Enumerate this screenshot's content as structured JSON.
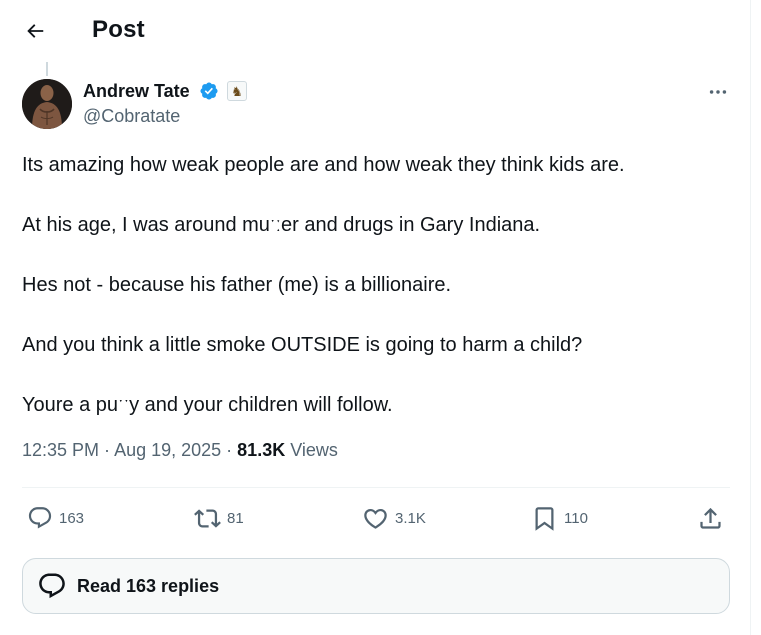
{
  "header": {
    "title": "Post"
  },
  "author": {
    "display_name": "Andrew Tate",
    "handle": "@Cobratate",
    "affiliation_badge": "♞"
  },
  "tweet": {
    "paragraphs": [
      "Its amazing how weak people are and how weak they think kids are.",
      "At his age, I was around muˑːer and drugs in Gary Indiana.",
      "Hes not - because his father (me) is a billionaire.",
      "And you think a little smoke OUTSIDE is going to harm a child?",
      "Youre a puˑˑy and your children will follow."
    ],
    "time": "12:35 PM",
    "separator": " · ",
    "date": "Aug 19, 2025",
    "views_count": "81.3K",
    "views_label": " Views"
  },
  "actions": {
    "replies": "163",
    "reposts": "81",
    "likes": "3.1K",
    "bookmarks": "110"
  },
  "read_replies": {
    "label": "Read 163 replies"
  },
  "icons": {
    "back": "arrow-left-icon",
    "verified": "verified-badge-icon",
    "more": "more-horizontal-icon",
    "reply": "reply-bubble-icon",
    "repost": "repost-icon",
    "like": "heart-icon",
    "bookmark": "bookmark-icon",
    "share": "share-icon"
  },
  "colors": {
    "verified": "#1d9bf0",
    "text": "#0f1419",
    "secondary": "#536471",
    "border": "#eff3f4"
  }
}
